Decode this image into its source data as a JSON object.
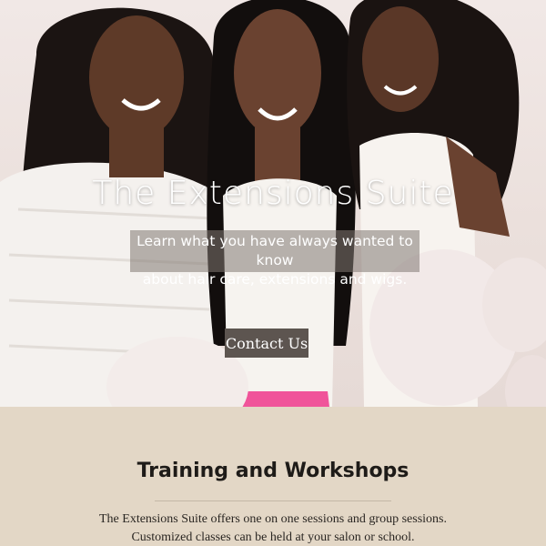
{
  "hero": {
    "title": "The Extensions Suite",
    "subtitle_line1": "Learn what you have always wanted to know",
    "subtitle_line2": "about hair care, extensions and wigs.",
    "button_label": "Contact Us"
  },
  "section": {
    "title": "Training and Workshops",
    "body_line1": "The Extensions Suite offers one on one sessions and group sessions.",
    "body_line2": "Customized classes can be held at your salon or school."
  },
  "colors": {
    "content_background": "#e3d7c6",
    "button_background": "#5d5550",
    "text_dark": "#1e1b18"
  }
}
